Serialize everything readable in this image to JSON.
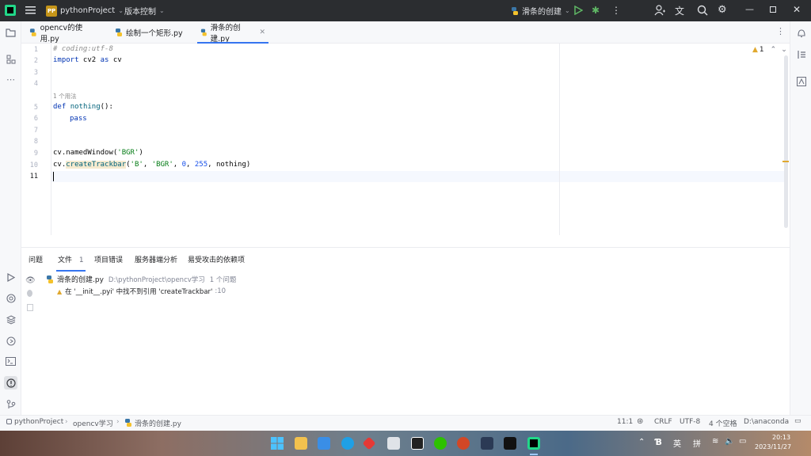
{
  "titlebar": {
    "project_badge": "PP",
    "project_name": "pythonProject",
    "vcs_menu": "版本控制",
    "run_config": "滑条的创建"
  },
  "tabs": [
    {
      "label": "opencv的使用.py"
    },
    {
      "label": "绘制一个矩形.py"
    },
    {
      "label": "滑条的创建.py"
    }
  ],
  "editor": {
    "warning_count": "1",
    "usage_hint": "1 个用法",
    "line_numbers": [
      "1",
      "2",
      "3",
      "4",
      "5",
      "6",
      "7",
      "8",
      "9",
      "10",
      "11"
    ],
    "lines": {
      "l1": "# coding:utf-8",
      "l2_kw1": "import",
      "l2_mod": " cv2 ",
      "l2_kw2": "as",
      "l2_alias": " cv",
      "l5_kw": "def",
      "l5_fn": "nothing",
      "l5_rest": "():",
      "l6_kw": "pass",
      "l9_a": "cv.namedWindow(",
      "l9_str": "'BGR'",
      "l9_b": ")",
      "l10_a": "cv.",
      "l10_call": "createTrackbar",
      "l10_b": "(",
      "l10_s1": "'B'",
      "l10_c": ", ",
      "l10_s2": "'BGR'",
      "l10_d": ", ",
      "l10_n1": "0",
      "l10_e": ", ",
      "l10_n2": "255",
      "l10_f": ", nothing)"
    }
  },
  "problems": {
    "tabs": [
      "问题",
      "文件",
      "项目错误",
      "服务器端分析",
      "易受攻击的依赖项"
    ],
    "file_count": "1",
    "file_name": "滑条的创建.py",
    "file_path": "D:\\pythonProject\\opencv学习",
    "problem_count": "1 个问题",
    "message": "在 '__init__.pyi' 中找不到引用 'createTrackbar'",
    "message_line": ":10"
  },
  "statusbar": {
    "crumb1": "pythonProject",
    "crumb2": "opencv学习",
    "crumb3": "滑条的创建.py",
    "position": "11:1",
    "line_sep": "CRLF",
    "encoding": "UTF-8",
    "indent": "4 个空格",
    "interpreter": "D:\\anaconda"
  },
  "taskbar": {
    "ime1": "英",
    "ime2": "拼",
    "time": "20:13",
    "date": "2023/11/27"
  },
  "colors": {
    "accent": "#3574f0",
    "titlebar": "#2b2d30",
    "warning": "#e0a82e"
  }
}
